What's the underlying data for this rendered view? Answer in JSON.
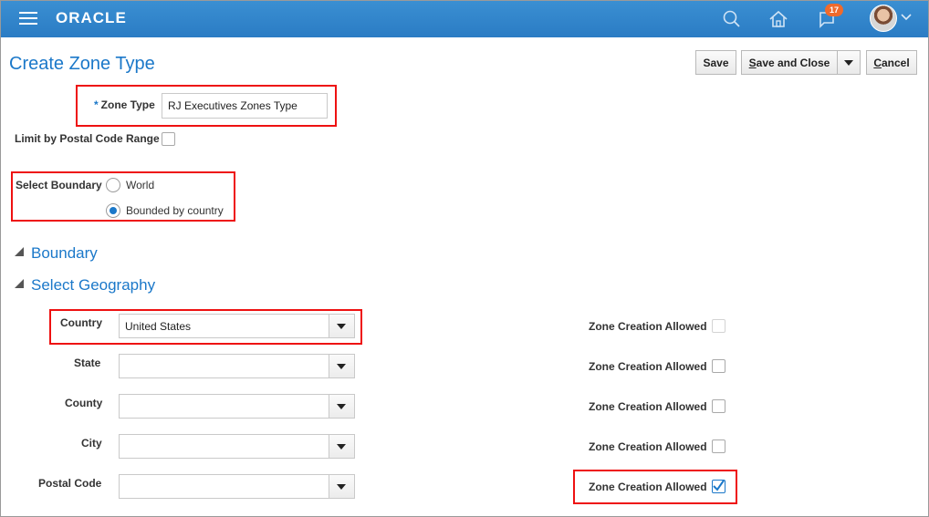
{
  "app": {
    "logo": "ORACLE",
    "notification_count": "17"
  },
  "page": {
    "title": "Create Zone Type"
  },
  "toolbar": {
    "save": "Save",
    "save_and_close_prefix": "S",
    "save_and_close_rest": "ave and Close",
    "cancel_prefix": "C",
    "cancel_rest": "ancel"
  },
  "form": {
    "zone_type_label": "Zone Type",
    "zone_type_required": "*",
    "zone_type_value": "RJ Executives Zones Type",
    "limit_label": "Limit by Postal Code Range",
    "boundary_label": "Select Boundary",
    "boundary_options": [
      {
        "label": "World",
        "selected": false
      },
      {
        "label": "Bounded by country",
        "selected": true
      }
    ]
  },
  "sections": {
    "boundary": "Boundary",
    "geography": "Select Geography"
  },
  "geography": {
    "rows": [
      {
        "label": "Country",
        "value": "United States",
        "zone_label": "Zone Creation Allowed",
        "zone_checked": false
      },
      {
        "label": "State",
        "value": "",
        "zone_label": "Zone Creation Allowed",
        "zone_checked": false
      },
      {
        "label": "County",
        "value": "",
        "zone_label": "Zone Creation Allowed",
        "zone_checked": false
      },
      {
        "label": "City",
        "value": "",
        "zone_label": "Zone Creation Allowed",
        "zone_checked": false
      },
      {
        "label": "Postal Code",
        "value": "",
        "zone_label": "Zone Creation Allowed",
        "zone_checked": true
      }
    ]
  },
  "colors": {
    "header": "#2b7cc4",
    "accent": "#1b78c9",
    "highlight": "#ee1111",
    "badge": "#f06a2b"
  }
}
